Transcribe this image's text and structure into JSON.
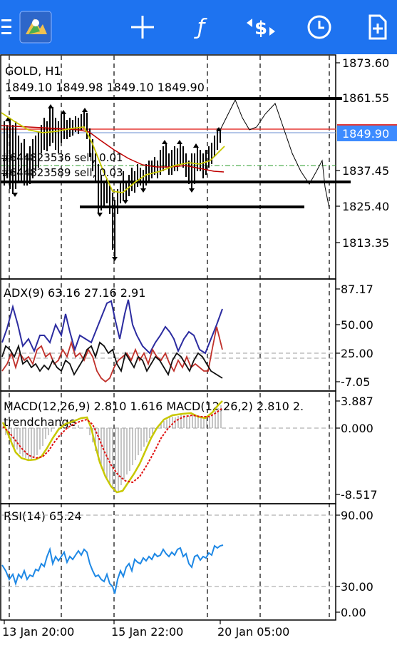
{
  "toolbar": {
    "icons": [
      "menu-icon",
      "metatrader-logo-icon",
      "crosshair-icon",
      "function-icon",
      "trade-icon",
      "clock-icon",
      "add-document-icon"
    ],
    "background": "#1e73f0"
  },
  "main_chart": {
    "symbol_label": "GOLD, H1",
    "ohlc_label": "1849.10 1849.98 1849.10 1849.90",
    "price_ticks": [
      "1873.60",
      "1861.55",
      "1837.45",
      "1825.40",
      "1813.35"
    ],
    "current_price": "1849.90",
    "orders": [
      "#644823536 sell, 0.01",
      "#644823589 sell, 0.03"
    ]
  },
  "adx": {
    "label": "ADX(9) 63.16 27.16 2.91",
    "ticks": [
      "87.17",
      "50.00",
      "25.00",
      "-7.05"
    ]
  },
  "macd": {
    "label": "MACD(12,26,9) 2.810 1.616 MACD(12,26,2) 2.810 2.",
    "sub_label": "trendchange",
    "ticks": [
      "3.887",
      "0.000",
      "-8.517"
    ]
  },
  "rsi": {
    "label": "RSI(14) 65.24",
    "ticks": [
      "90.00",
      "30.00",
      "0.00"
    ]
  },
  "time_axis": [
    "13 Jan 20:00",
    "15 Jan 22:00",
    "20 Jan 05:00"
  ],
  "colors": {
    "ask_line": "#e53935",
    "price_tag": "#3d8bff",
    "adx_main": "#2c2ca0",
    "adx_plus": "#c0302a",
    "adx_minus": "#111111",
    "macd_hist": "#9e9e9e",
    "macd_signal": "#e01010",
    "macd_line": "#c8c800",
    "rsi_line": "#1e88e5"
  }
}
